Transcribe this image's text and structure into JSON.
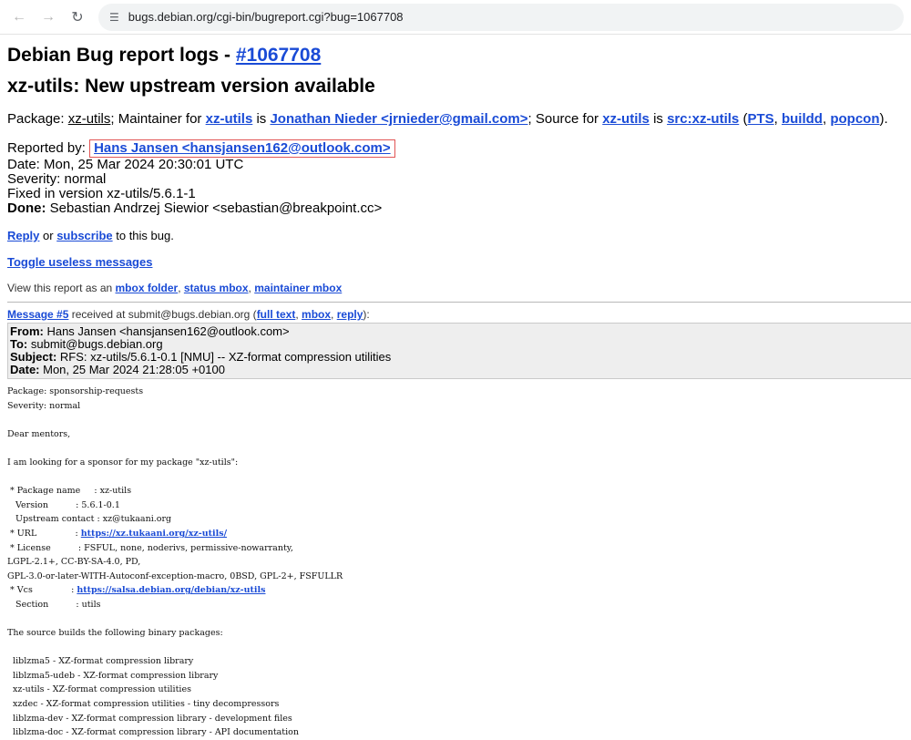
{
  "browser": {
    "url": "bugs.debian.org/cgi-bin/bugreport.cgi?bug=1067708"
  },
  "page": {
    "title_prefix": "Debian Bug report logs - ",
    "bug_link": "#1067708",
    "subtitle": "xz-utils: New upstream version available"
  },
  "pkgline": {
    "package_label": "Package: ",
    "package": "xz-utils",
    "maintainer_prefix": "; Maintainer for ",
    "maint_pkg": "xz-utils",
    "is1": " is ",
    "maintainer": "Jonathan Nieder <jrnieder@gmail.com>",
    "source_prefix": "; Source for ",
    "src_pkg": "xz-utils",
    "is2": " is ",
    "src": "src:xz-utils",
    "open_paren": " (",
    "pts": "PTS",
    "comma1": ", ",
    "buildd": "buildd",
    "comma2": ", ",
    "popcon": "popcon",
    "close": ")."
  },
  "info": {
    "reported_label": "Reported by: ",
    "reporter": "Hans Jansen <hansjansen162@outlook.com>",
    "date": "Date: Mon, 25 Mar 2024 20:30:01 UTC",
    "severity": "Severity: normal",
    "fixed": "Fixed in version xz-utils/5.6.1-1",
    "done_label": "Done:",
    "done_value": " Sebastian Andrzej Siewior <sebastian@breakpoint.cc>"
  },
  "reply_line": {
    "reply": "Reply",
    "or": " or ",
    "subscribe": "subscribe",
    "rest": " to this bug."
  },
  "toggle": "Toggle useless messages",
  "view_line": {
    "prefix": "View this report as an ",
    "mbox_folder": "mbox folder",
    "c1": ", ",
    "status_mbox": "status mbox",
    "c2": ", ",
    "maintainer_mbox": "maintainer mbox"
  },
  "message": {
    "link": "Message #5",
    "received": " received at submit@bugs.debian.org (",
    "full_text": "full text",
    "c1": ", ",
    "mbox": "mbox",
    "c2": ", ",
    "reply": "reply",
    "end": "):",
    "from_label": "From:",
    "from": " Hans Jansen <hansjansen162@outlook.com>",
    "to_label": "To:",
    "to": " submit@bugs.debian.org",
    "subject_label": "Subject:",
    "subject": " RFS: xz-utils/5.6.1-0.1 [NMU] -- XZ-format compression utilities",
    "date_label": "Date:",
    "date": " Mon, 25 Mar 2024 21:28:05 +0100"
  },
  "body": {
    "p1": "Package: sponsorship-requests\nSeverity: normal\n\nDear mentors,\n\nI am looking for a sponsor for my package \"xz-utils\":\n\n * Package name     : xz-utils\n   Version          : 5.6.1-0.1\n   Upstream contact : xz@tukaani.org\n * URL              : ",
    "url": "https://xz.tukaani.org/xz-utils/",
    "p2": "\n * License          : FSFUL, none, noderivs, permissive-nowarranty,\nLGPL-2.1+, CC-BY-SA-4.0, PD,\nGPL-3.0-or-later-WITH-Autoconf-exception-macro, 0BSD, GPL-2+, FSFULLR\n * Vcs              : ",
    "vcs": "https://salsa.debian.org/debian/xz-utils",
    "p3": "\n   Section          : utils\n\nThe source builds the following binary packages:\n\n  liblzma5 - XZ-format compression library\n  liblzma5-udeb - XZ-format compression library\n  xz-utils - XZ-format compression utilities\n  xzdec - XZ-format compression utilities - tiny decompressors\n  liblzma-dev - XZ-format compression library - development files\n  liblzma-doc - XZ-format compression library - API documentation"
  }
}
